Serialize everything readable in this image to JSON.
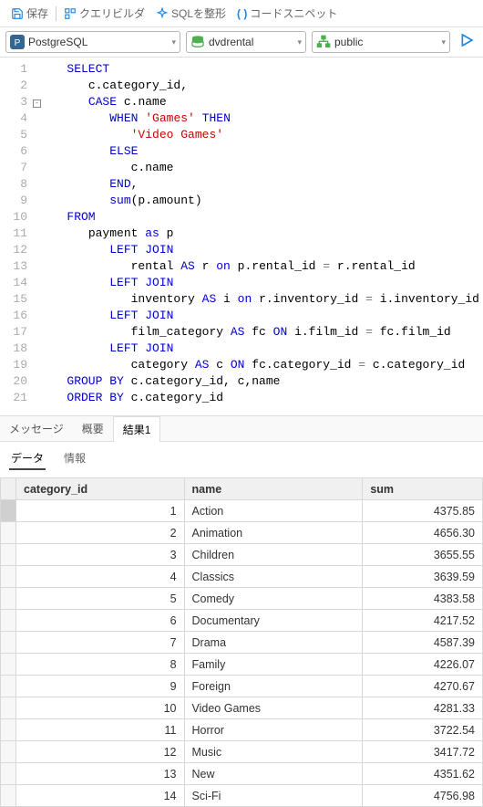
{
  "toolbar": {
    "save": "保存",
    "query_builder": "クエリビルダ",
    "format_sql": "SQLを整形",
    "code_snippet": "コードスニペット"
  },
  "connection": {
    "driver": "PostgreSQL",
    "database": "dvdrental",
    "schema": "public"
  },
  "sql": {
    "lines": [
      {
        "n": 1,
        "i": 1,
        "t": [
          [
            "kw",
            "SELECT"
          ]
        ]
      },
      {
        "n": 2,
        "i": 2,
        "t": [
          [
            "ident",
            "c.category_id,"
          ]
        ]
      },
      {
        "n": 3,
        "i": 2,
        "t": [
          [
            "kw",
            "CASE"
          ],
          [
            "sp",
            " "
          ],
          [
            "ident",
            "c.name"
          ]
        ],
        "fold": true
      },
      {
        "n": 4,
        "i": 3,
        "t": [
          [
            "kw",
            "WHEN"
          ],
          [
            "sp",
            " "
          ],
          [
            "str",
            "'Games'"
          ],
          [
            "sp",
            " "
          ],
          [
            "kw",
            "THEN"
          ]
        ]
      },
      {
        "n": 5,
        "i": 4,
        "t": [
          [
            "str",
            "'Video Games'"
          ]
        ]
      },
      {
        "n": 6,
        "i": 3,
        "t": [
          [
            "kw",
            "ELSE"
          ]
        ]
      },
      {
        "n": 7,
        "i": 4,
        "t": [
          [
            "ident",
            "c.name"
          ]
        ]
      },
      {
        "n": 8,
        "i": 3,
        "t": [
          [
            "kw",
            "END"
          ],
          [
            "ident",
            ","
          ]
        ]
      },
      {
        "n": 9,
        "i": 3,
        "t": [
          [
            "kw",
            "sum"
          ],
          [
            "ident",
            "(p.amount)"
          ]
        ]
      },
      {
        "n": 10,
        "i": 1,
        "t": [
          [
            "kw",
            "FROM"
          ]
        ]
      },
      {
        "n": 11,
        "i": 2,
        "t": [
          [
            "ident",
            "payment "
          ],
          [
            "kw",
            "as"
          ],
          [
            "ident",
            " p"
          ]
        ]
      },
      {
        "n": 12,
        "i": 3,
        "t": [
          [
            "kw",
            "LEFT JOIN"
          ]
        ]
      },
      {
        "n": 13,
        "i": 4,
        "t": [
          [
            "ident",
            "rental "
          ],
          [
            "kw",
            "AS"
          ],
          [
            "ident",
            " r "
          ],
          [
            "kw",
            "on"
          ],
          [
            "ident",
            " p.rental_id "
          ],
          [
            "op",
            "="
          ],
          [
            "ident",
            " r.rental_id"
          ]
        ]
      },
      {
        "n": 14,
        "i": 3,
        "t": [
          [
            "kw",
            "LEFT JOIN"
          ]
        ]
      },
      {
        "n": 15,
        "i": 4,
        "t": [
          [
            "ident",
            "inventory "
          ],
          [
            "kw",
            "AS"
          ],
          [
            "ident",
            " i "
          ],
          [
            "kw",
            "on"
          ],
          [
            "ident",
            " r.inventory_id "
          ],
          [
            "op",
            "="
          ],
          [
            "ident",
            " i.inventory_id"
          ]
        ]
      },
      {
        "n": 16,
        "i": 3,
        "t": [
          [
            "kw",
            "LEFT JOIN"
          ]
        ]
      },
      {
        "n": 17,
        "i": 4,
        "t": [
          [
            "ident",
            "film_category "
          ],
          [
            "kw",
            "AS"
          ],
          [
            "ident",
            " fc "
          ],
          [
            "kw",
            "ON"
          ],
          [
            "ident",
            " i.film_id "
          ],
          [
            "op",
            "="
          ],
          [
            "ident",
            " fc.film_id"
          ]
        ]
      },
      {
        "n": 18,
        "i": 3,
        "t": [
          [
            "kw",
            "LEFT JOIN"
          ]
        ]
      },
      {
        "n": 19,
        "i": 4,
        "t": [
          [
            "ident",
            "category "
          ],
          [
            "kw",
            "AS"
          ],
          [
            "ident",
            " c "
          ],
          [
            "kw",
            "ON"
          ],
          [
            "ident",
            " fc.category_id "
          ],
          [
            "op",
            "="
          ],
          [
            "ident",
            " c.category_id"
          ]
        ]
      },
      {
        "n": 20,
        "i": 1,
        "t": [
          [
            "kw",
            "GROUP BY"
          ],
          [
            "ident",
            " c.category_id, c,name"
          ]
        ]
      },
      {
        "n": 21,
        "i": 1,
        "t": [
          [
            "kw",
            "ORDER BY"
          ],
          [
            "ident",
            " c.category_id"
          ]
        ]
      }
    ]
  },
  "result_tabs": {
    "messages": "メッセージ",
    "summary": "概要",
    "result1": "結果1"
  },
  "sub_tabs": {
    "data": "データ",
    "info": "情報"
  },
  "grid": {
    "columns": [
      "category_id",
      "name",
      "sum"
    ],
    "rows": [
      {
        "id": 1,
        "name": "Action",
        "sum": "4375.85",
        "selected": true
      },
      {
        "id": 2,
        "name": "Animation",
        "sum": "4656.30"
      },
      {
        "id": 3,
        "name": "Children",
        "sum": "3655.55"
      },
      {
        "id": 4,
        "name": "Classics",
        "sum": "3639.59"
      },
      {
        "id": 5,
        "name": "Comedy",
        "sum": "4383.58"
      },
      {
        "id": 6,
        "name": "Documentary",
        "sum": "4217.52"
      },
      {
        "id": 7,
        "name": "Drama",
        "sum": "4587.39"
      },
      {
        "id": 8,
        "name": "Family",
        "sum": "4226.07"
      },
      {
        "id": 9,
        "name": "Foreign",
        "sum": "4270.67"
      },
      {
        "id": 10,
        "name": "Video Games",
        "sum": "4281.33"
      },
      {
        "id": 11,
        "name": "Horror",
        "sum": "3722.54"
      },
      {
        "id": 12,
        "name": "Music",
        "sum": "3417.72"
      },
      {
        "id": 13,
        "name": "New",
        "sum": "4351.62"
      },
      {
        "id": 14,
        "name": "Sci-Fi",
        "sum": "4756.98"
      }
    ]
  }
}
